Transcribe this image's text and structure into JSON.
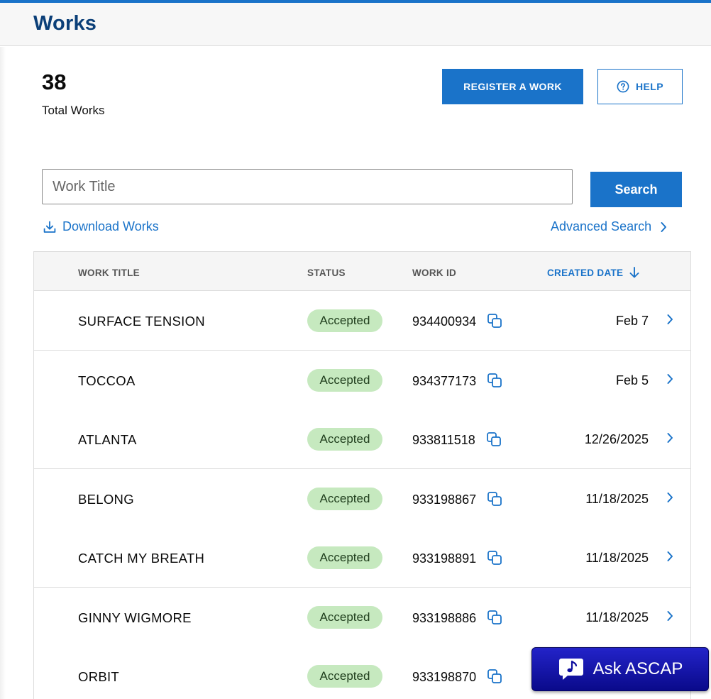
{
  "header": {
    "title": "Works"
  },
  "summary": {
    "count": "38",
    "label": "Total Works"
  },
  "actions": {
    "register_label": "REGISTER A WORK",
    "help_label": "HELP"
  },
  "search": {
    "placeholder": "Work Title",
    "value": "",
    "button_label": "Search"
  },
  "links": {
    "download_label": "Download Works",
    "advanced_label": "Advanced Search"
  },
  "table": {
    "columns": {
      "title": "WORK TITLE",
      "status": "STATUS",
      "work_id": "WORK ID",
      "created_date": "CREATED DATE"
    },
    "sort": {
      "column": "created_date",
      "direction": "descending"
    },
    "rows": [
      {
        "title": "SURFACE TENSION",
        "status": "Accepted",
        "work_id": "934400934",
        "created": "Feb 7"
      },
      {
        "title": "TOCCOA",
        "status": "Accepted",
        "work_id": "934377173",
        "created": "Feb 5"
      },
      {
        "title": "ATLANTA",
        "status": "Accepted",
        "work_id": "933811518",
        "created": "12/26/2025"
      },
      {
        "title": "BELONG",
        "status": "Accepted",
        "work_id": "933198867",
        "created": "11/18/2025"
      },
      {
        "title": "CATCH MY BREATH",
        "status": "Accepted",
        "work_id": "933198891",
        "created": "11/18/2025"
      },
      {
        "title": "GINNY WIGMORE",
        "status": "Accepted",
        "work_id": "933198886",
        "created": "11/18/2025"
      },
      {
        "title": "ORBIT",
        "status": "Accepted",
        "work_id": "933198870",
        "created": ""
      }
    ]
  },
  "chat": {
    "label": "Ask ASCAP"
  },
  "icons": {
    "help": "question-circle-icon",
    "download": "download-icon",
    "advanced": "chevron-right-icon",
    "sort": "arrow-down-icon",
    "copy": "copy-icon",
    "row_chevron": "chevron-right-icon",
    "chat": "music-note-chat-icon"
  },
  "colors": {
    "brand_blue": "#1a73c9",
    "title_navy": "#0b3f78",
    "accepted_badge": "#c6e9bf",
    "chat_button": "#1a1ab8"
  }
}
